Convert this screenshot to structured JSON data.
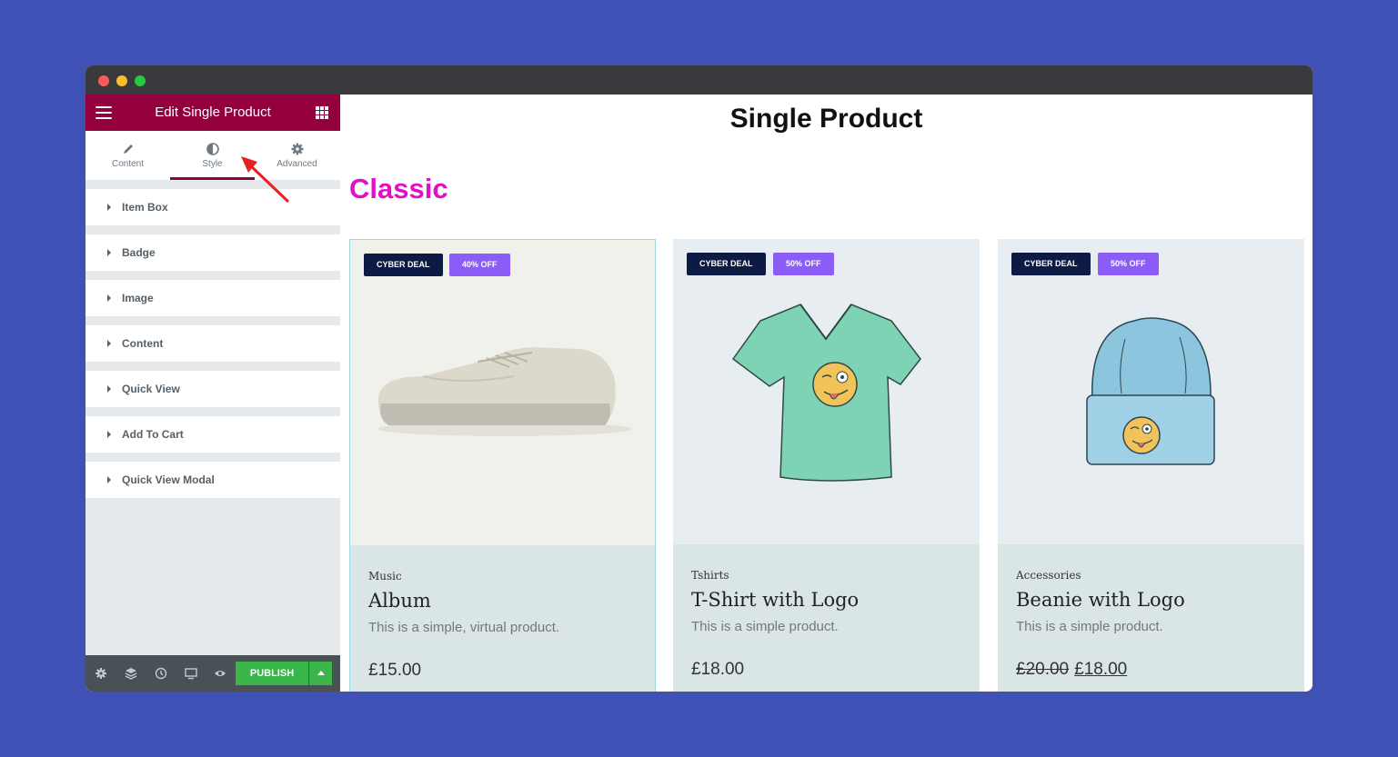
{
  "sidebar": {
    "title": "Edit Single Product",
    "tabs": [
      {
        "label": "Content",
        "icon": "pencil-icon"
      },
      {
        "label": "Style",
        "icon": "half-circle-icon"
      },
      {
        "label": "Advanced",
        "icon": "gear-icon"
      }
    ],
    "active_tab": "Style",
    "sections": [
      "Item Box",
      "Badge",
      "Image",
      "Content",
      "Quick View",
      "Add To Cart",
      "Quick View Modal"
    ],
    "footer": {
      "publish_label": "PUBLISH"
    }
  },
  "main": {
    "page_title": "Single Product",
    "style_heading": "Classic",
    "products": [
      {
        "deal_badge": "CYBER DEAL",
        "discount_badge": "40% OFF",
        "category": "Music",
        "name": "Album",
        "description": "This is a simple, virtual product.",
        "price": "£15.00"
      },
      {
        "deal_badge": "CYBER DEAL",
        "discount_badge": "50% OFF",
        "category": "Tshirts",
        "name": "T-Shirt with Logo",
        "description": "This is a simple product.",
        "price": "£18.00"
      },
      {
        "deal_badge": "CYBER DEAL",
        "discount_badge": "50% OFF",
        "category": "Accessories",
        "name": "Beanie with Logo",
        "description": "This is a simple product.",
        "old_price": "£20.00",
        "price": "£18.00"
      }
    ]
  },
  "colors": {
    "background": "#3f51b5",
    "editor_accent": "#93003c",
    "heading_magenta": "#e010c8",
    "badge_navy": "#0d1a44",
    "badge_purple": "#8b5cf6",
    "publish_green": "#39b54a"
  }
}
